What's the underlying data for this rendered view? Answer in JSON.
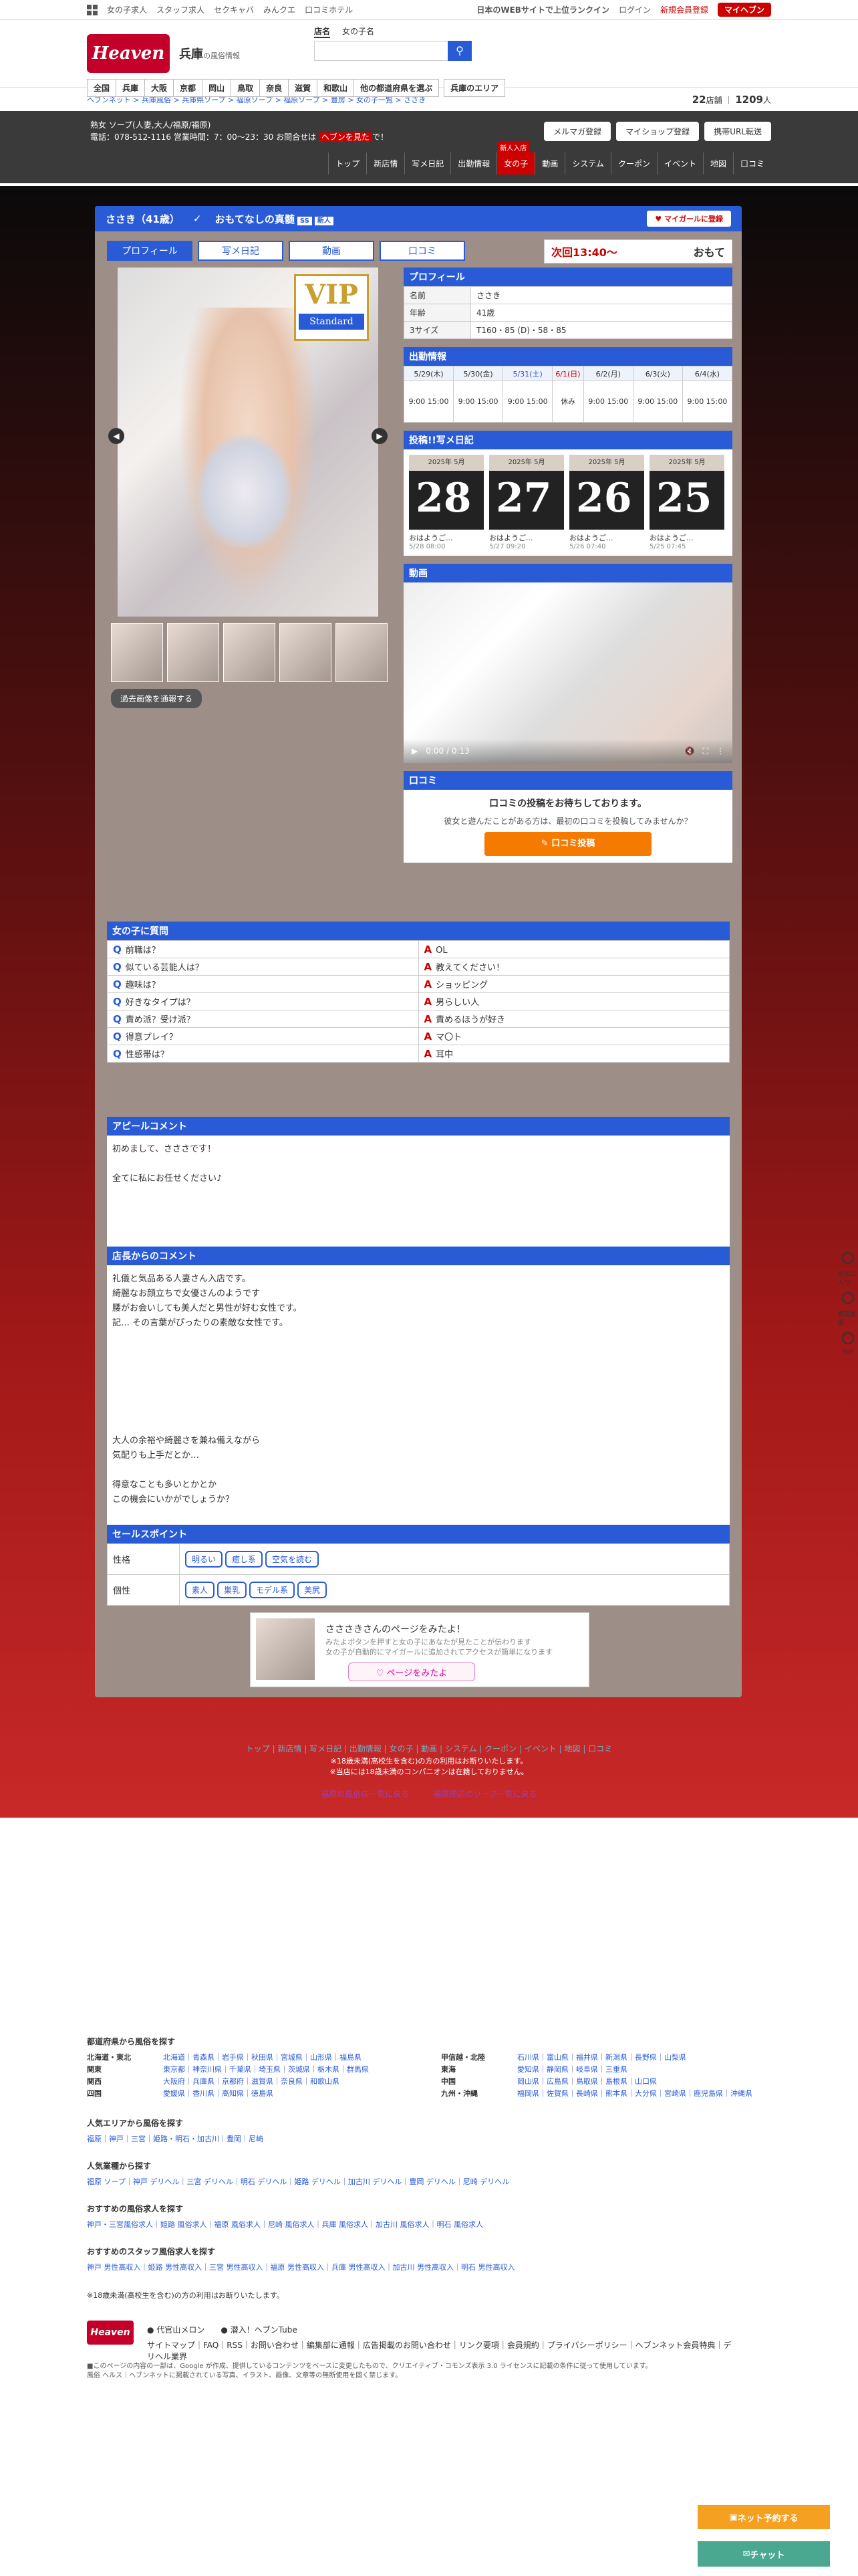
{
  "top": {
    "links": [
      "女の子求人",
      "スタッフ求人",
      "セクキャバ",
      "みんクエ",
      "口コミホテル"
    ],
    "right": [
      "日本のWEBサイトで上位ランクイン",
      "ログイン",
      "新規会員登録"
    ],
    "my": "マイヘブン"
  },
  "header": {
    "logo": "Heaven",
    "region": "兵庫",
    "sub": "の風俗情報",
    "search_tabs": [
      "店名",
      "女の子名"
    ],
    "search_placeholder": "",
    "nav": [
      "全国",
      "兵庫",
      "大阪",
      "京都",
      "岡山",
      "鳥取",
      "奈良",
      "滋賀",
      "和歌山",
      "他の都道府県を選ぶ",
      "兵庫のエリア"
    ]
  },
  "crumbs": {
    "path": "ヘブンネット > 兵庫風俗 > 兵庫県ソープ > 福原ソープ > 福原ソープ > 豊房 > 女の子一覧 > ささき",
    "shops": "22",
    "shops_unit": "店舗",
    "girls": "1209",
    "girls_unit": "人"
  },
  "shop": {
    "line1": "熟女 ソープ(人妻,大人/福原/福原)",
    "line2": "電話：078-512-1116 営業時間：7：00〜23：30 お問合せは",
    "line2b": "ヘブンを見た",
    "line2c": "で！",
    "btns": [
      "メルマガ登録",
      "マイショップ登録",
      "携帯URL転送"
    ],
    "nav": [
      "トップ",
      "新店情",
      "写メ日記",
      "出勤情報",
      "女の子",
      "動画",
      "システム",
      "クーポン",
      "イベント",
      "地図",
      "口コミ"
    ],
    "nav_badge": "新人入店"
  },
  "girl": {
    "name": "ささき（41歳）",
    "catch": "おもてなしの真髄",
    "tags": [
      "SS",
      "新人"
    ],
    "mygirl": "マイガールに登録",
    "tabs": [
      "プロフィール",
      "写メ日記",
      "動画",
      "口コミ"
    ],
    "next_label": "次回13:40〜",
    "next_sub": "おもて",
    "vip": "VIP",
    "vip_sub": "Standard",
    "photo_btn": "過去画像を通報する"
  },
  "profile": {
    "head": "プロフィール",
    "rows": [
      {
        "k": "名前",
        "v": "ささき"
      },
      {
        "k": "年齢",
        "v": "41歳"
      },
      {
        "k": "3サイズ",
        "v": "T160・85 (D)・58・85"
      }
    ]
  },
  "schedule": {
    "head": "出勤情報",
    "days": [
      "5/29(木)",
      "5/30(金)",
      "5/31(土)",
      "6/1(日)",
      "6/2(月)",
      "6/3(火)",
      "6/4(水)"
    ],
    "times": [
      "9:00 15:00",
      "9:00 15:00",
      "9:00 15:00",
      "休み",
      "9:00 15:00",
      "9:00 15:00",
      "9:00 15:00"
    ]
  },
  "diary": {
    "head": "投稿!!写メ日記",
    "items": [
      {
        "n": "28",
        "y": "2025年 5月",
        "cap": "おはようご...",
        "dt": "5/28 08:00"
      },
      {
        "n": "27",
        "y": "2025年 5月",
        "cap": "おはようご...",
        "dt": "5/27 09:20"
      },
      {
        "n": "26",
        "y": "2025年 5月",
        "cap": "おはようご...",
        "dt": "5/26 07:40"
      },
      {
        "n": "25",
        "y": "2025年 5月",
        "cap": "おはようご...",
        "dt": "5/25 07:45"
      }
    ]
  },
  "video": {
    "head": "動画",
    "time": "0:00 / 0:13"
  },
  "kuchikomi": {
    "head": "口コミ",
    "t1": "口コミの投稿をお待ちしております。",
    "t2": "彼女と遊んだことがある方は、最初の口コミを投稿してみませんか？",
    "btn": "✎ 口コミ投稿"
  },
  "qa": {
    "head": "女の子に質問",
    "rows": [
      {
        "q": "前職は？",
        "a": "OL"
      },
      {
        "q": "似ている芸能人は？",
        "a": "教えてください！"
      },
      {
        "q": "趣味は？",
        "a": "ショッピング"
      },
      {
        "q": "好きなタイプは？",
        "a": "男らしい人"
      },
      {
        "q": "責め派？受け派？",
        "a": "責めるほうが好き"
      },
      {
        "q": "得意プレイ？",
        "a": "マ〇ト"
      },
      {
        "q": "性感帯は？",
        "a": "耳中"
      }
    ]
  },
  "appeal": {
    "head": "アピールコメント",
    "lines": [
      "初めまして、さささです！",
      "",
      "全てに私にお任せください♪"
    ]
  },
  "manager": {
    "head": "店長からのコメント",
    "lines": [
      "礼儀と気品ある人妻さん入店です。",
      "綺麗なお顔立ちで女優さんのようです",
      "腰がお会いしても美人だと男性が好む女性です。",
      "記… その言葉がぴったりの素敵な女性です。",
      "",
      "",
      "",
      "",
      "",
      "大人の余裕や綺麗さを兼ね備えながら",
      "気配りも上手だとか…",
      "",
      "得意なことも多いとかとか",
      "この機会にいかがでしょうか？"
    ]
  },
  "sales": {
    "head": "セールスポイント",
    "rows": [
      {
        "k": "性格",
        "v": [
          "明るい",
          "癒し系",
          "空気を読む"
        ]
      },
      {
        "k": "個性",
        "v": [
          "素人",
          "巣乳",
          "モデル系",
          "美尻"
        ]
      }
    ]
  },
  "banner": {
    "t1": "さささきさんのページをみたよ！",
    "t2a": "みたよボタンを押すと女の子にあなたが見たことが伝わります",
    "t2b": "女の子が自動的にマイガールに追加されてアクセスが簡単になります",
    "btn": "♡ ページをみたよ"
  },
  "footnav": {
    "links": [
      "トップ",
      "新店情",
      "写メ日記",
      "出勤情報",
      "女の子",
      "動画",
      "システム",
      "クーポン",
      "イベント",
      "地図",
      "口コミ"
    ],
    "warn1": "※18歳未満(高校生を含む)の方の利用はお断りいたします。",
    "warn2": "※当店には18歳未満のコンパニオンは在籍しておりません。",
    "back1": "福原の風俗店一覧に戻る",
    "back2": "福原周辺のソープ一覧に戻る"
  },
  "areas": {
    "head": "都道府県から風俗を探す",
    "left": [
      {
        "k": "北海道・東北",
        "v": "北海道｜青森県｜岩手県｜秋田県｜宮城県｜山形県｜福島県"
      },
      {
        "k": "関東",
        "v": "東京都｜神奈川県｜千葉県｜埼玉県｜茨城県｜栃木県｜群馬県"
      },
      {
        "k": "関西",
        "v": "大阪府｜兵庫県｜京都府｜滋賀県｜奈良県｜和歌山県"
      },
      {
        "k": "四国",
        "v": "愛媛県｜香川県｜高知県｜徳島県"
      }
    ],
    "right": [
      {
        "k": "甲信越・北陸",
        "v": "石川県｜富山県｜福井県｜新潟県｜長野県｜山梨県"
      },
      {
        "k": "東海",
        "v": "愛知県｜静岡県｜岐阜県｜三重県"
      },
      {
        "k": "中国",
        "v": "岡山県｜広島県｜鳥取県｜島根県｜山口県"
      },
      {
        "k": "九州・沖縄",
        "v": "福岡県｜佐賀県｜長崎県｜熊本県｜大分県｜宮崎県｜鹿児島県｜沖縄県"
      }
    ],
    "pop_head": "人気エリアから風俗を探す",
    "pop": "福原｜神戸｜三宮｜姫路・明石・加古川｜豊岡｜尼崎",
    "gyo_head": "人気業種から探す",
    "gyo": "福原 ソープ｜神戸 デリヘル｜三宮 デリヘル｜明石 デリヘル｜姫路 デリヘル｜加古川 デリヘル｜豊岡 デリヘル｜尼崎 デリヘル",
    "job_head": "おすすめの風俗求人を探す",
    "job": "神戸・三宮風俗求人｜姫路 風俗求人｜福原 風俗求人｜尼崎 風俗求人｜兵庫 風俗求人｜加古川 風俗求人｜明石 風俗求人",
    "staff_head": "おすすめのスタッフ風俗求人を探す",
    "staff": "神戸 男性高収入｜姫路 男性高収入｜三宮 男性高収入｜福原 男性高収入｜兵庫 男性高収入｜加古川 男性高収入｜明石 男性高収入",
    "note18": "※18歳未満(高校生を含む)の方の利用はお断りいたします。"
  },
  "footer": {
    "logo": "Heaven",
    "sns1": "代官山メロン",
    "sns2": "潜入！ヘブンTube",
    "links": "サイトマップ｜FAQ｜RSS｜お問い合わせ｜編集部に通報｜広告掲載のお問い合わせ｜リンク要項｜会員規約｜プライバシーポリシー｜ヘブンネット会員特典｜デリヘル業界",
    "n1": "■このページの内容の一部は、Google が作成、提供しているコンテンツをベースに変更したもので、クリエイティブ・コモンズ表示 3.0 ライセンスに記載の条件に従って使用しています。",
    "n2": "風俗 ヘルス｜ヘブンネットに掲載されている写真、イラスト、画像、文章等の無断使用を固く禁じます。"
  },
  "side": [
    "お気に入り",
    "閲覧履歴",
    "TOP"
  ],
  "float": {
    "net": "ネット予約する",
    "chat": "チャット"
  }
}
